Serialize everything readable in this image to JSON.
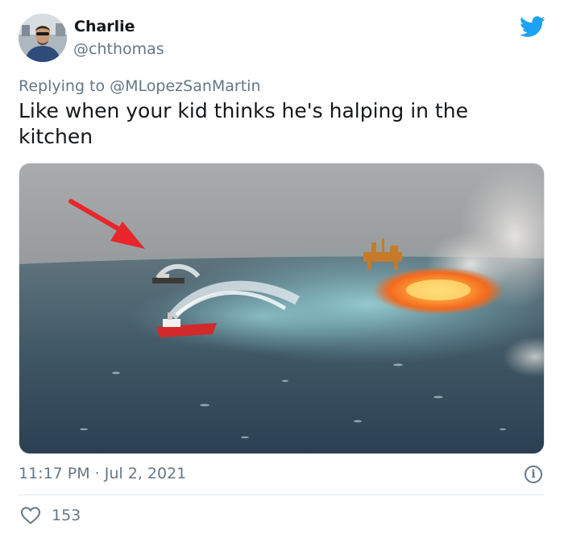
{
  "user": {
    "name": "Charlie",
    "handle": "@chthomas"
  },
  "reply": {
    "prefix": "Replying to ",
    "mention": "@MLopezSanMartin"
  },
  "tweet": {
    "text": "Like when your kid thinks he's halping in the kitchen",
    "timestamp": "11:17 PM · Jul 2, 2021",
    "like_count": "153"
  },
  "icons": {
    "brand": "twitter-bird-icon",
    "info": "info-icon",
    "like": "heart-icon"
  },
  "colors": {
    "brand_blue": "#1da1f2",
    "secondary_text": "#657786",
    "primary_text": "#14171a",
    "divider": "#e1e8ed",
    "arrow_red": "#e8262b"
  }
}
